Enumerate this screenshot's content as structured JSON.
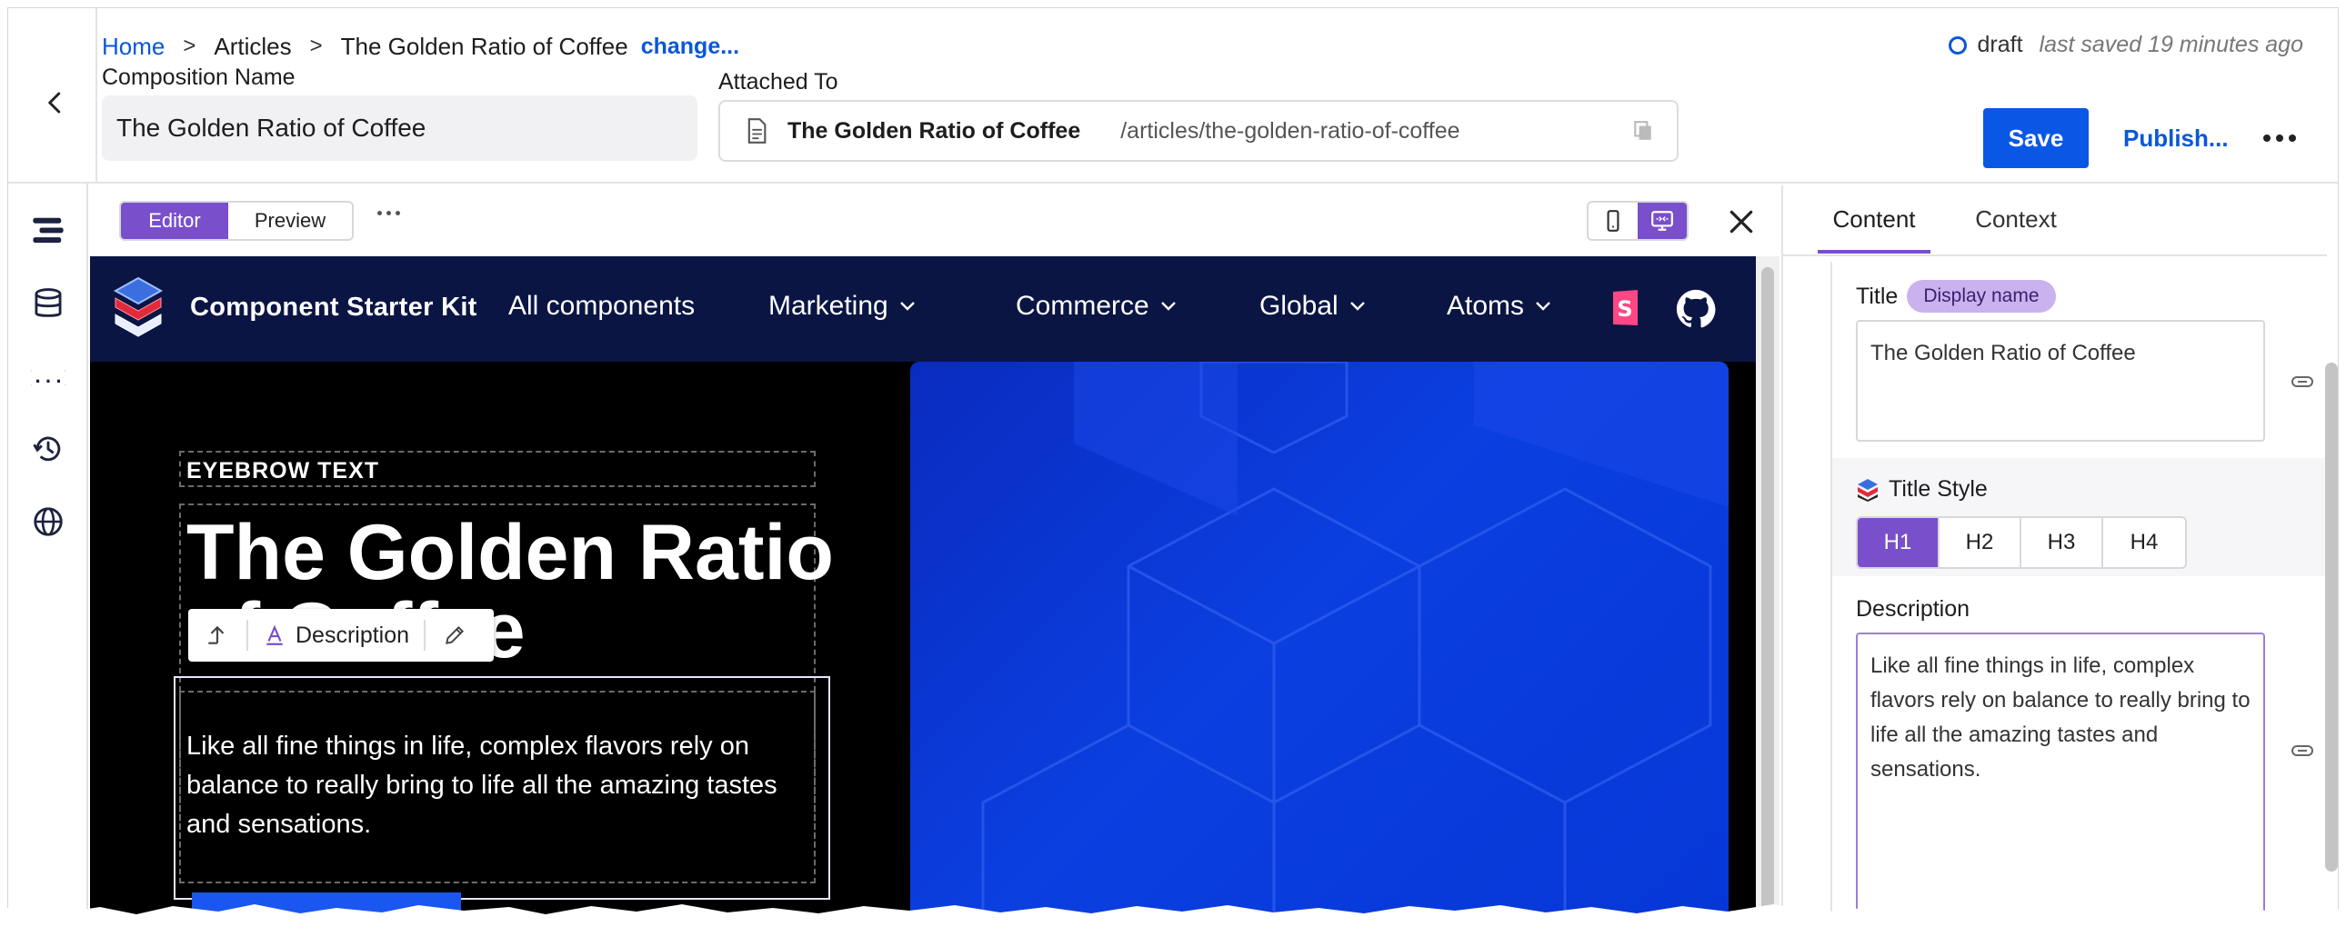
{
  "header": {
    "breadcrumb": {
      "home": "Home",
      "articles": "Articles",
      "current": "The Golden Ratio of Coffee",
      "change": "change..."
    },
    "composition_name_label": "Composition Name",
    "composition_name_value": "The Golden Ratio of Coffee",
    "attached_to_label": "Attached To",
    "attached_title": "The Golden Ratio of Coffee",
    "attached_path": "/articles/the-golden-ratio-of-coffee",
    "status": "draft",
    "last_saved": "last saved 19 minutes ago",
    "save_label": "Save",
    "publish_label": "Publish..."
  },
  "canvas_toolbar": {
    "editor_tab": "Editor",
    "preview_tab": "Preview"
  },
  "site": {
    "name": "Component Starter Kit",
    "nav": [
      "All components",
      "Marketing",
      "Commerce",
      "Global",
      "Atoms"
    ],
    "eyebrow": "EYEBROW TEXT",
    "hero_title": "The Golden Ratio of Coffee",
    "hero_description": "Like all fine things in life, complex flavors rely on balance to really bring to life all the amazing tastes and sensations.",
    "floating_toolbar_label": "Description"
  },
  "panel": {
    "tabs": [
      "Content",
      "Context"
    ],
    "title_label": "Title",
    "title_badge": "Display name",
    "title_value": "The Golden Ratio of Coffee",
    "title_style_label": "Title Style",
    "title_style_options": [
      "H1",
      "H2",
      "H3",
      "H4"
    ],
    "title_style_selected": "H1",
    "description_label": "Description",
    "description_value": "Like all fine things in life, complex flavors rely on balance to really bring to life all the amazing tastes and sensations."
  },
  "colors": {
    "accent": "#7a4fcb",
    "primary": "#0a57e6",
    "link": "#0a57d8",
    "site_nav_bg": "#0b1544",
    "hero_blue": "#0b3fe0"
  },
  "icons": {
    "back": "chevron-left-icon",
    "document": "document-icon",
    "copy": "copy-icon",
    "rail": [
      "components-icon",
      "database-icon",
      "variables-icon",
      "history-icon",
      "globe-icon"
    ],
    "devices": [
      "mobile-icon",
      "desktop-icon"
    ],
    "close": "close-icon",
    "storybook": "storybook-icon",
    "github": "github-icon"
  }
}
